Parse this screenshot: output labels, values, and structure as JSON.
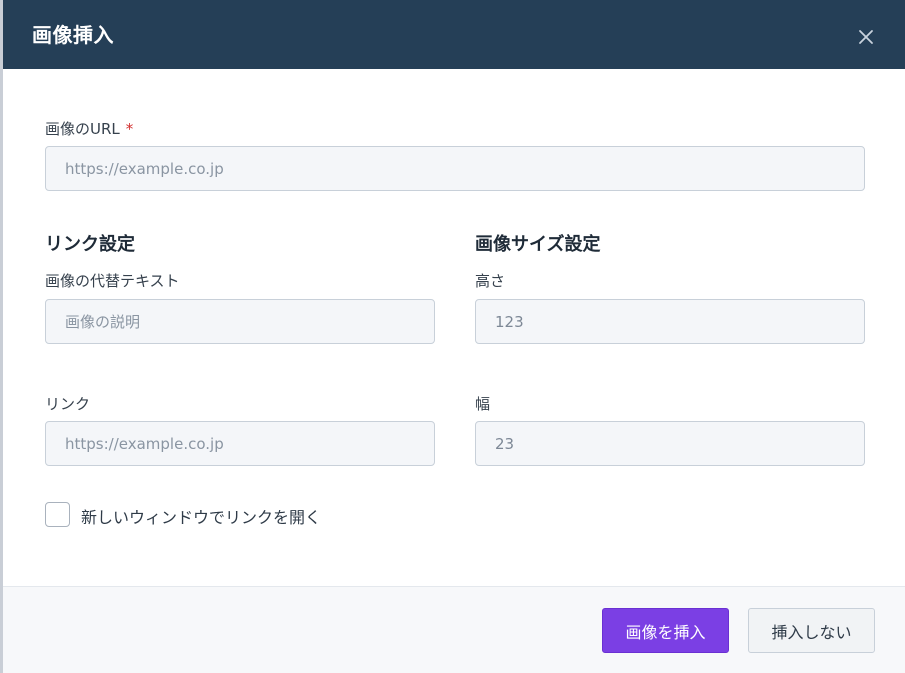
{
  "dialog": {
    "title": "画像挿入",
    "close_icon": "close-icon"
  },
  "image_url": {
    "label": "画像のURL",
    "required_mark": "*",
    "placeholder": "https://example.co.jp",
    "value": ""
  },
  "link_settings": {
    "section_title": "リンク設定",
    "alt_label": "画像の代替テキスト",
    "alt_placeholder": "画像の説明",
    "link_label": "リンク",
    "link_placeholder": "https://example.co.jp",
    "new_window_label": "新しいウィンドウでリンクを開く",
    "new_window_checked": false
  },
  "size_settings": {
    "section_title": "画像サイズ設定",
    "height_label": "高さ",
    "height_value": "123",
    "width_label": "幅",
    "width_value": "23"
  },
  "footer": {
    "insert_label": "画像を挿入",
    "cancel_label": "挿入しない"
  },
  "colors": {
    "header_bg": "#253f57",
    "primary": "#7b3fe4",
    "required": "#d12b2b"
  }
}
